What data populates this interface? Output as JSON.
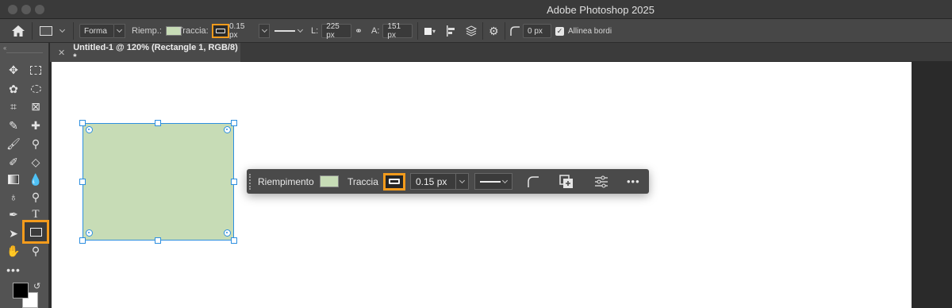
{
  "app": {
    "title": "Adobe Photoshop 2025"
  },
  "options_bar": {
    "mode_value": "Forma",
    "fill_label": "Riemp.:",
    "stroke_label": "Traccia:",
    "stroke_width": "0.15 px",
    "width_label": "L:",
    "width_value": "225 px",
    "height_label": "A:",
    "height_value": "151 px",
    "radius_value": "0 px",
    "align_edges_label": "Allinea bordi",
    "align_edges_checked": true
  },
  "document": {
    "tab_title": "Untitled-1 @ 120% (Rectangle 1, RGB/8) *"
  },
  "context_bar": {
    "fill_label": "Riempimento",
    "stroke_label": "Traccia",
    "stroke_width": "0.15 px"
  },
  "colors": {
    "accent_highlight": "#f39b1c",
    "shape_fill": "#c7dcb6",
    "selection_blue": "#2d8fe0",
    "foreground": "#000000",
    "background": "#ffffff"
  },
  "toolbar": {
    "tools": [
      "move-icon",
      "marquee-icon",
      "lasso-icon",
      "quick-select-icon",
      "crop-icon",
      "frame-icon",
      "eyedropper-icon",
      "healing-icon",
      "brush-icon",
      "stamp-icon",
      "history-brush-icon",
      "eraser-icon",
      "gradient-icon",
      "blur-icon",
      "dodge-icon",
      "pen-icon",
      "type-icon",
      "path-select-icon",
      "rectangle-icon",
      "hand-icon",
      "zoom-icon",
      "more-icon"
    ],
    "active_tool": "rectangle-icon"
  }
}
